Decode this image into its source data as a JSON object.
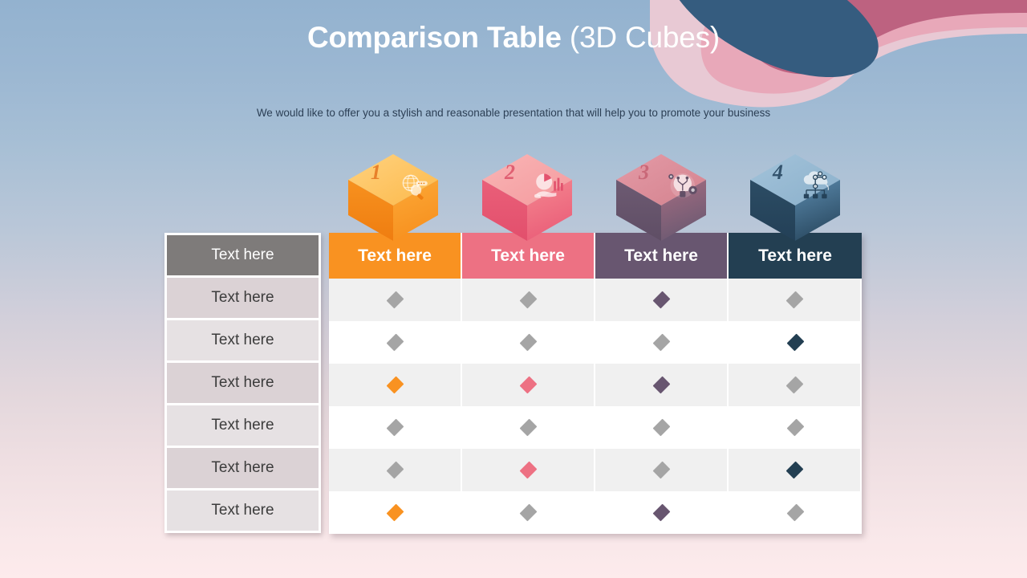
{
  "slide": {
    "title_strong": "Comparison Table ",
    "title_light": "(3D Cubes)",
    "subtitle": "We would like to offer you a stylish and reasonable presentation that will help you to promote your business"
  },
  "colors": {
    "background_top": "#93b2cf",
    "background_bottom": "#fdebec",
    "deco_rose": "#bd6280",
    "deco_pink": "#e8a8b9",
    "deco_pale_pink": "#e8c9d4",
    "deco_navy": "#355c7f",
    "title_text": "#ffffff",
    "subtitle_text": "#2c3f55",
    "header_gray": "#7e7b7a",
    "orange": "#f99221",
    "pink": "#ed7183",
    "purple": "#685670",
    "navy": "#233f52",
    "neutral_gray": "#a5a5a5",
    "row_dark": "#f0f0f0",
    "row_light": "#ffffff",
    "left_row_dark": "#dbd2d5",
    "left_row_light": "#e6e1e3"
  },
  "cubes": [
    {
      "number": "1",
      "icon": "globe-search-icon",
      "top_light": "#ffd27f",
      "top_dark": "#fcb94b",
      "left_face": "#f7911f",
      "left_face_dark": "#ef7d10",
      "right_face": "#fca938",
      "num_color": "#e8802a"
    },
    {
      "number": "2",
      "icon": "pie-chart-hand-icon",
      "top_light": "#f9b5b5",
      "top_dark": "#f49a9e",
      "left_face": "#ea5f79",
      "left_face_dark": "#e24f6c",
      "right_face": "#f58790",
      "num_color": "#e05f72"
    },
    {
      "number": "3",
      "icon": "lightbulb-gear-icon",
      "top_light": "#e49aa6",
      "top_dark": "#d4838f",
      "left_face": "#6d5a72",
      "left_face_dark": "#5f4e65",
      "right_face": "#a66d82",
      "num_color": "#c96878"
    },
    {
      "number": "4",
      "icon": "cloud-network-icon",
      "top_light": "#a3c3da",
      "top_dark": "#8bb0cb",
      "left_face": "#2c4c64",
      "left_face_dark": "#234057",
      "right_face": "#5b8aad",
      "num_color": "#33536d"
    }
  ],
  "left_column": {
    "header": "Text here",
    "rows": [
      "Text here",
      "Text here",
      "Text here",
      "Text here",
      "Text here",
      "Text here"
    ]
  },
  "table": {
    "headers": [
      {
        "label": "Text here",
        "color": "#f99221"
      },
      {
        "label": "Text here",
        "color": "#ed7183"
      },
      {
        "label": "Text here",
        "color": "#685670"
      },
      {
        "label": "Text here",
        "color": "#233f52"
      }
    ],
    "rows": [
      {
        "zebra": "dark",
        "marks": [
          "#a5a5a5",
          "#a5a5a5",
          "#685670",
          "#a5a5a5"
        ]
      },
      {
        "zebra": "light",
        "marks": [
          "#a5a5a5",
          "#a5a5a5",
          "#a5a5a5",
          "#233f52"
        ]
      },
      {
        "zebra": "dark",
        "marks": [
          "#f99221",
          "#ed7183",
          "#685670",
          "#a5a5a5"
        ]
      },
      {
        "zebra": "light",
        "marks": [
          "#a5a5a5",
          "#a5a5a5",
          "#a5a5a5",
          "#a5a5a5"
        ]
      },
      {
        "zebra": "dark",
        "marks": [
          "#a5a5a5",
          "#ed7183",
          "#a5a5a5",
          "#233f52"
        ]
      },
      {
        "zebra": "light",
        "marks": [
          "#f99221",
          "#a5a5a5",
          "#685670",
          "#a5a5a5"
        ]
      }
    ]
  }
}
